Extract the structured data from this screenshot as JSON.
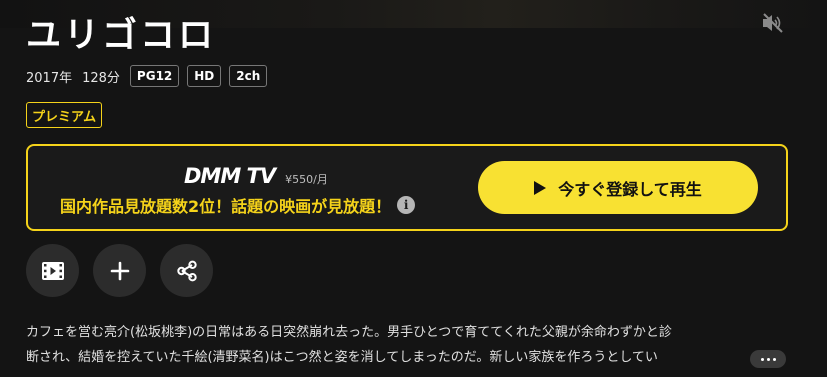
{
  "title": "ユリゴコロ",
  "meta": {
    "year": "2017年",
    "duration": "128分",
    "badges": [
      "PG12",
      "HD",
      "2ch"
    ]
  },
  "premium_label": "プレミアム",
  "promo": {
    "brand": "DMM TV",
    "price": "¥550/月",
    "catchcopy": "国内作品見放題数2位！話題の映画が見放題！",
    "info_glyph": "i",
    "cta_label": "今すぐ登録して再生"
  },
  "actions": [
    {
      "name": "trailer",
      "icon": "film-icon"
    },
    {
      "name": "add-to-list",
      "icon": "plus-icon"
    },
    {
      "name": "share",
      "icon": "share-icon"
    }
  ],
  "description": {
    "line1": "カフェを営む亮介(松坂桃李)の日常はある日突然崩れ去った。男手ひとつで育ててくれた父親が余命わずかと診",
    "line2": "断され、結婚を控えていた千絵(清野菜名)はこつ然と姿を消してしまったのだ。新しい家族を作ろうとしてい"
  },
  "colors": {
    "accent": "#f5d31a",
    "cta": "#f8e132",
    "background": "#141414"
  },
  "icons": {
    "mute": "speaker-muted-icon",
    "more": "more-dots-icon"
  }
}
